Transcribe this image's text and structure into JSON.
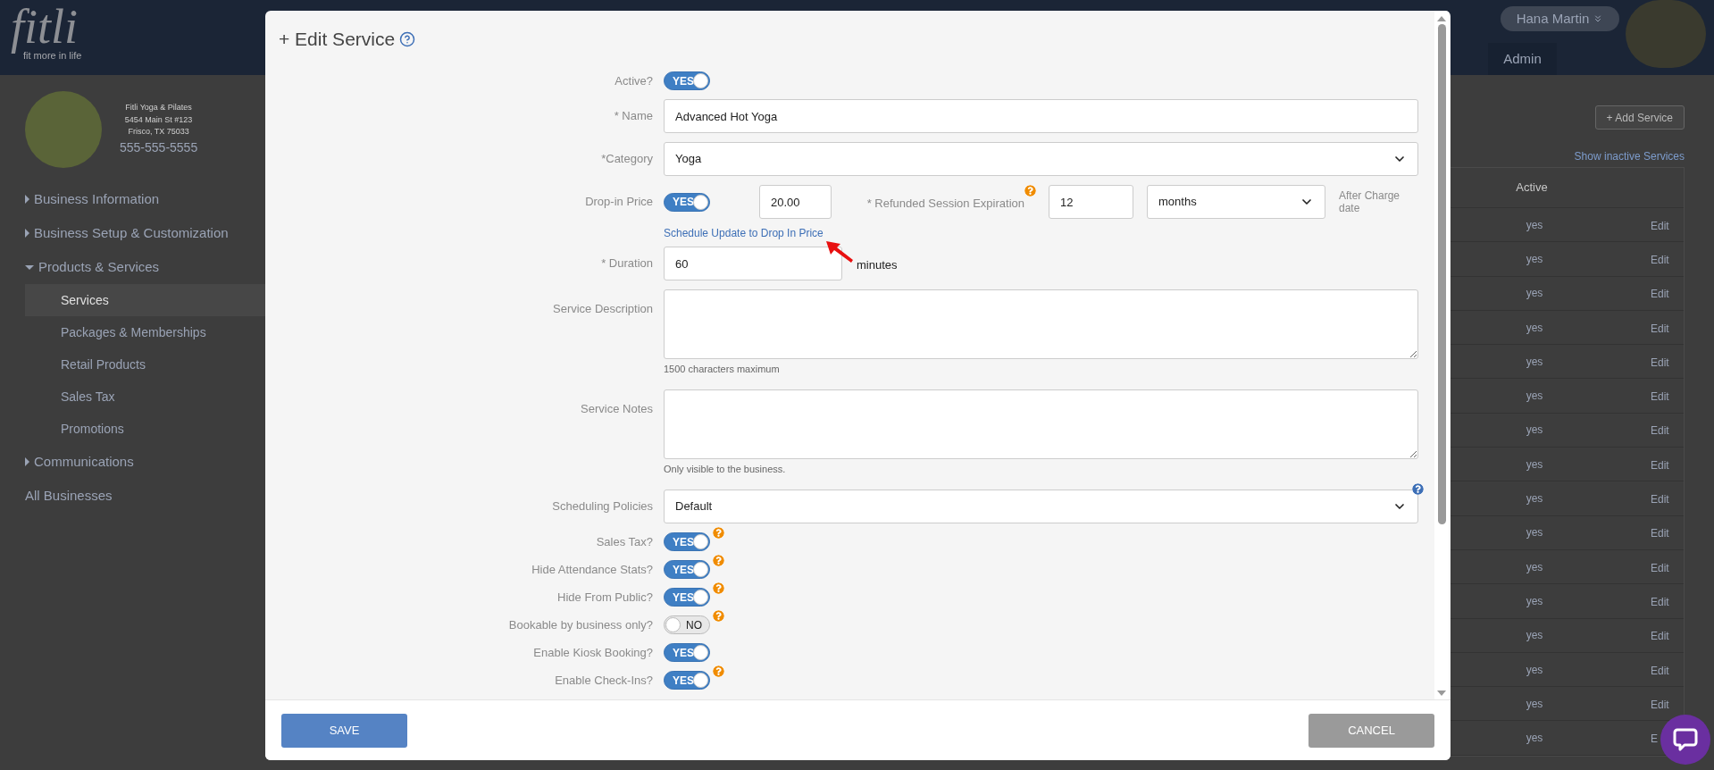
{
  "header": {
    "logo": "fitli",
    "tagline": "fit more in life",
    "user": "Hana Martin",
    "nav_tab": "Admin"
  },
  "business": {
    "name": "Fitli Yoga & Pilates",
    "address": [
      "5454 Main St #123",
      "Frisco, TX 75033"
    ],
    "phone": "555-555-5555"
  },
  "nav": [
    {
      "kind": "group",
      "label": "Business Information",
      "expanded": false
    },
    {
      "kind": "group",
      "label": "Business Setup & Customization",
      "expanded": false
    },
    {
      "kind": "group",
      "label": "Products & Services",
      "expanded": true,
      "children": [
        {
          "label": "Services",
          "selected": true
        },
        {
          "label": "Packages & Memberships",
          "selected": false
        },
        {
          "label": "Retail Products",
          "selected": false
        },
        {
          "label": "Sales Tax",
          "selected": false
        },
        {
          "label": "Promotions",
          "selected": false
        }
      ]
    },
    {
      "kind": "group",
      "label": "Communications",
      "expanded": false
    },
    {
      "kind": "link",
      "label": "All Businesses"
    }
  ],
  "main": {
    "add_button": "+ Add Service",
    "inactive_link": "Show inactive Services",
    "table": {
      "columns": [
        "Active"
      ],
      "rows": [
        {
          "active": "yes",
          "action": "Edit"
        },
        {
          "active": "yes",
          "action": "Edit"
        },
        {
          "active": "yes",
          "action": "Edit"
        },
        {
          "active": "yes",
          "action": "Edit"
        },
        {
          "active": "yes",
          "action": "Edit"
        },
        {
          "active": "yes",
          "action": "Edit"
        },
        {
          "active": "yes",
          "action": "Edit"
        },
        {
          "active": "yes",
          "action": "Edit"
        },
        {
          "active": "yes",
          "action": "Edit"
        },
        {
          "active": "yes",
          "action": "Edit"
        },
        {
          "active": "yes",
          "action": "Edit"
        },
        {
          "active": "yes",
          "action": "Edit"
        },
        {
          "active": "yes",
          "action": "Edit"
        },
        {
          "active": "yes",
          "action": "Edit"
        },
        {
          "active": "yes",
          "action": "Edit"
        },
        {
          "active": "yes",
          "action": "E"
        }
      ]
    }
  },
  "modal": {
    "title": "+ Edit Service",
    "fields": [
      {
        "kind": "toggle",
        "label": "Active?",
        "on": true,
        "text": "YES",
        "help": false
      },
      {
        "kind": "text",
        "label": "* Name",
        "value": "Advanced Hot Yoga"
      },
      {
        "kind": "select",
        "label": "*Category",
        "value": "Yoga",
        "help": false
      },
      {
        "kind": "price",
        "label": "Drop-in Price",
        "on": true,
        "text": "YES",
        "value": "20.00",
        "link": "Schedule Update to Drop In Price",
        "expiration": {
          "label": "* Refunded Session Expiration",
          "help": true,
          "value": "12",
          "unit": "months",
          "note": "After Charge date"
        }
      },
      {
        "kind": "duration",
        "label": "* Duration",
        "value": "60",
        "unit": "minutes"
      },
      {
        "kind": "textarea",
        "label": "Service Description",
        "hint": "1500 characters maximum"
      },
      {
        "kind": "textarea",
        "label": "Service Notes",
        "hint": "Only visible to the business."
      },
      {
        "kind": "select",
        "label": "Scheduling Policies",
        "value": "Default",
        "help": true
      },
      {
        "kind": "toggle",
        "label": "Sales Tax?",
        "on": true,
        "text": "YES",
        "help": true
      },
      {
        "kind": "toggle",
        "label": "Hide Attendance Stats?",
        "on": true,
        "text": "YES",
        "help": true
      },
      {
        "kind": "toggle",
        "label": "Hide From Public?",
        "on": true,
        "text": "YES",
        "help": true
      },
      {
        "kind": "toggle",
        "label": "Bookable by business only?",
        "on": false,
        "text": "NO",
        "help": true
      },
      {
        "kind": "toggle",
        "label": "Enable Kiosk Booking?",
        "on": true,
        "text": "YES",
        "help": false
      },
      {
        "kind": "toggle",
        "label": "Enable Check-Ins?",
        "on": true,
        "text": "YES",
        "help": true
      }
    ],
    "save": "SAVE",
    "cancel": "CANCEL"
  }
}
